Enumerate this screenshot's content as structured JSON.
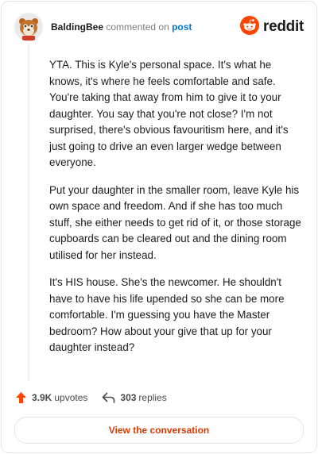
{
  "header": {
    "username": "BaldingBee",
    "verb": "commented on",
    "target": "post",
    "brand": "reddit"
  },
  "comment": {
    "paragraphs": [
      "YTA. This is Kyle's personal space. It's what he knows, it's where he feels comfortable and safe. You're taking that away from him to give it to your daughter. You say that you're not close? I'm not surprised, there's obvious favouritism here, and it's just going to drive an even larger wedge between everyone.",
      "Put your daughter in the smaller room, leave Kyle his own space and freedom. And if she has too much stuff, she either needs to get rid of it, or those storage cupboards can be cleared out and the dining room utilised for her instead.",
      "It's HIS house. She's the newcomer. He shouldn't have to have his life upended so she can be more comfortable. I'm guessing you have the Master bedroom? How about your give that up for your daughter instead?"
    ]
  },
  "stats": {
    "upvotes_count": "3.9K",
    "upvotes_label": "upvotes",
    "replies_count": "303",
    "replies_label": "replies"
  },
  "cta": {
    "label": "View the conversation"
  },
  "colors": {
    "accent": "#d93a00",
    "link": "#0079d3",
    "upvote": "#ff4500"
  },
  "icons": {
    "avatar": "avatar-icon",
    "brand": "reddit-logo-icon",
    "upvote": "upvote-arrow-icon",
    "reply": "reply-arrow-icon"
  }
}
